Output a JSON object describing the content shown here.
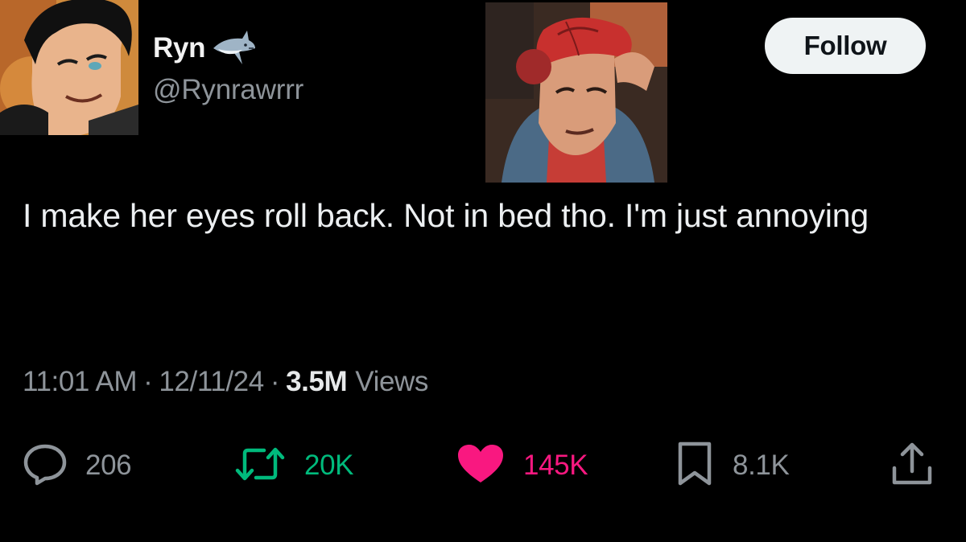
{
  "author": {
    "display_name": "Ryn",
    "handle": "@Rynrawrrr",
    "emoji_icon": "shark-emoji"
  },
  "follow": {
    "label": "Follow"
  },
  "tweet": {
    "text": "I make her eyes roll back. Not in bed tho. I'm just annoying"
  },
  "meta": {
    "time": "11:01 AM",
    "separator": "·",
    "date": "12/11/24",
    "views_count": "3.5M",
    "views_label": "Views"
  },
  "actions": {
    "reply": {
      "icon": "reply-icon",
      "count": "206"
    },
    "retweet": {
      "icon": "retweet-icon",
      "count": "20K"
    },
    "like": {
      "icon": "heart-icon",
      "count": "145K"
    },
    "bookmark": {
      "icon": "bookmark-icon",
      "count": "8.1K"
    },
    "share": {
      "icon": "share-icon"
    }
  },
  "colors": {
    "background": "#000000",
    "text": "#e7e9ea",
    "secondary": "#8e949a",
    "retweet": "#00ba7c",
    "like": "#f91880",
    "follow_bg": "#eff3f4"
  }
}
